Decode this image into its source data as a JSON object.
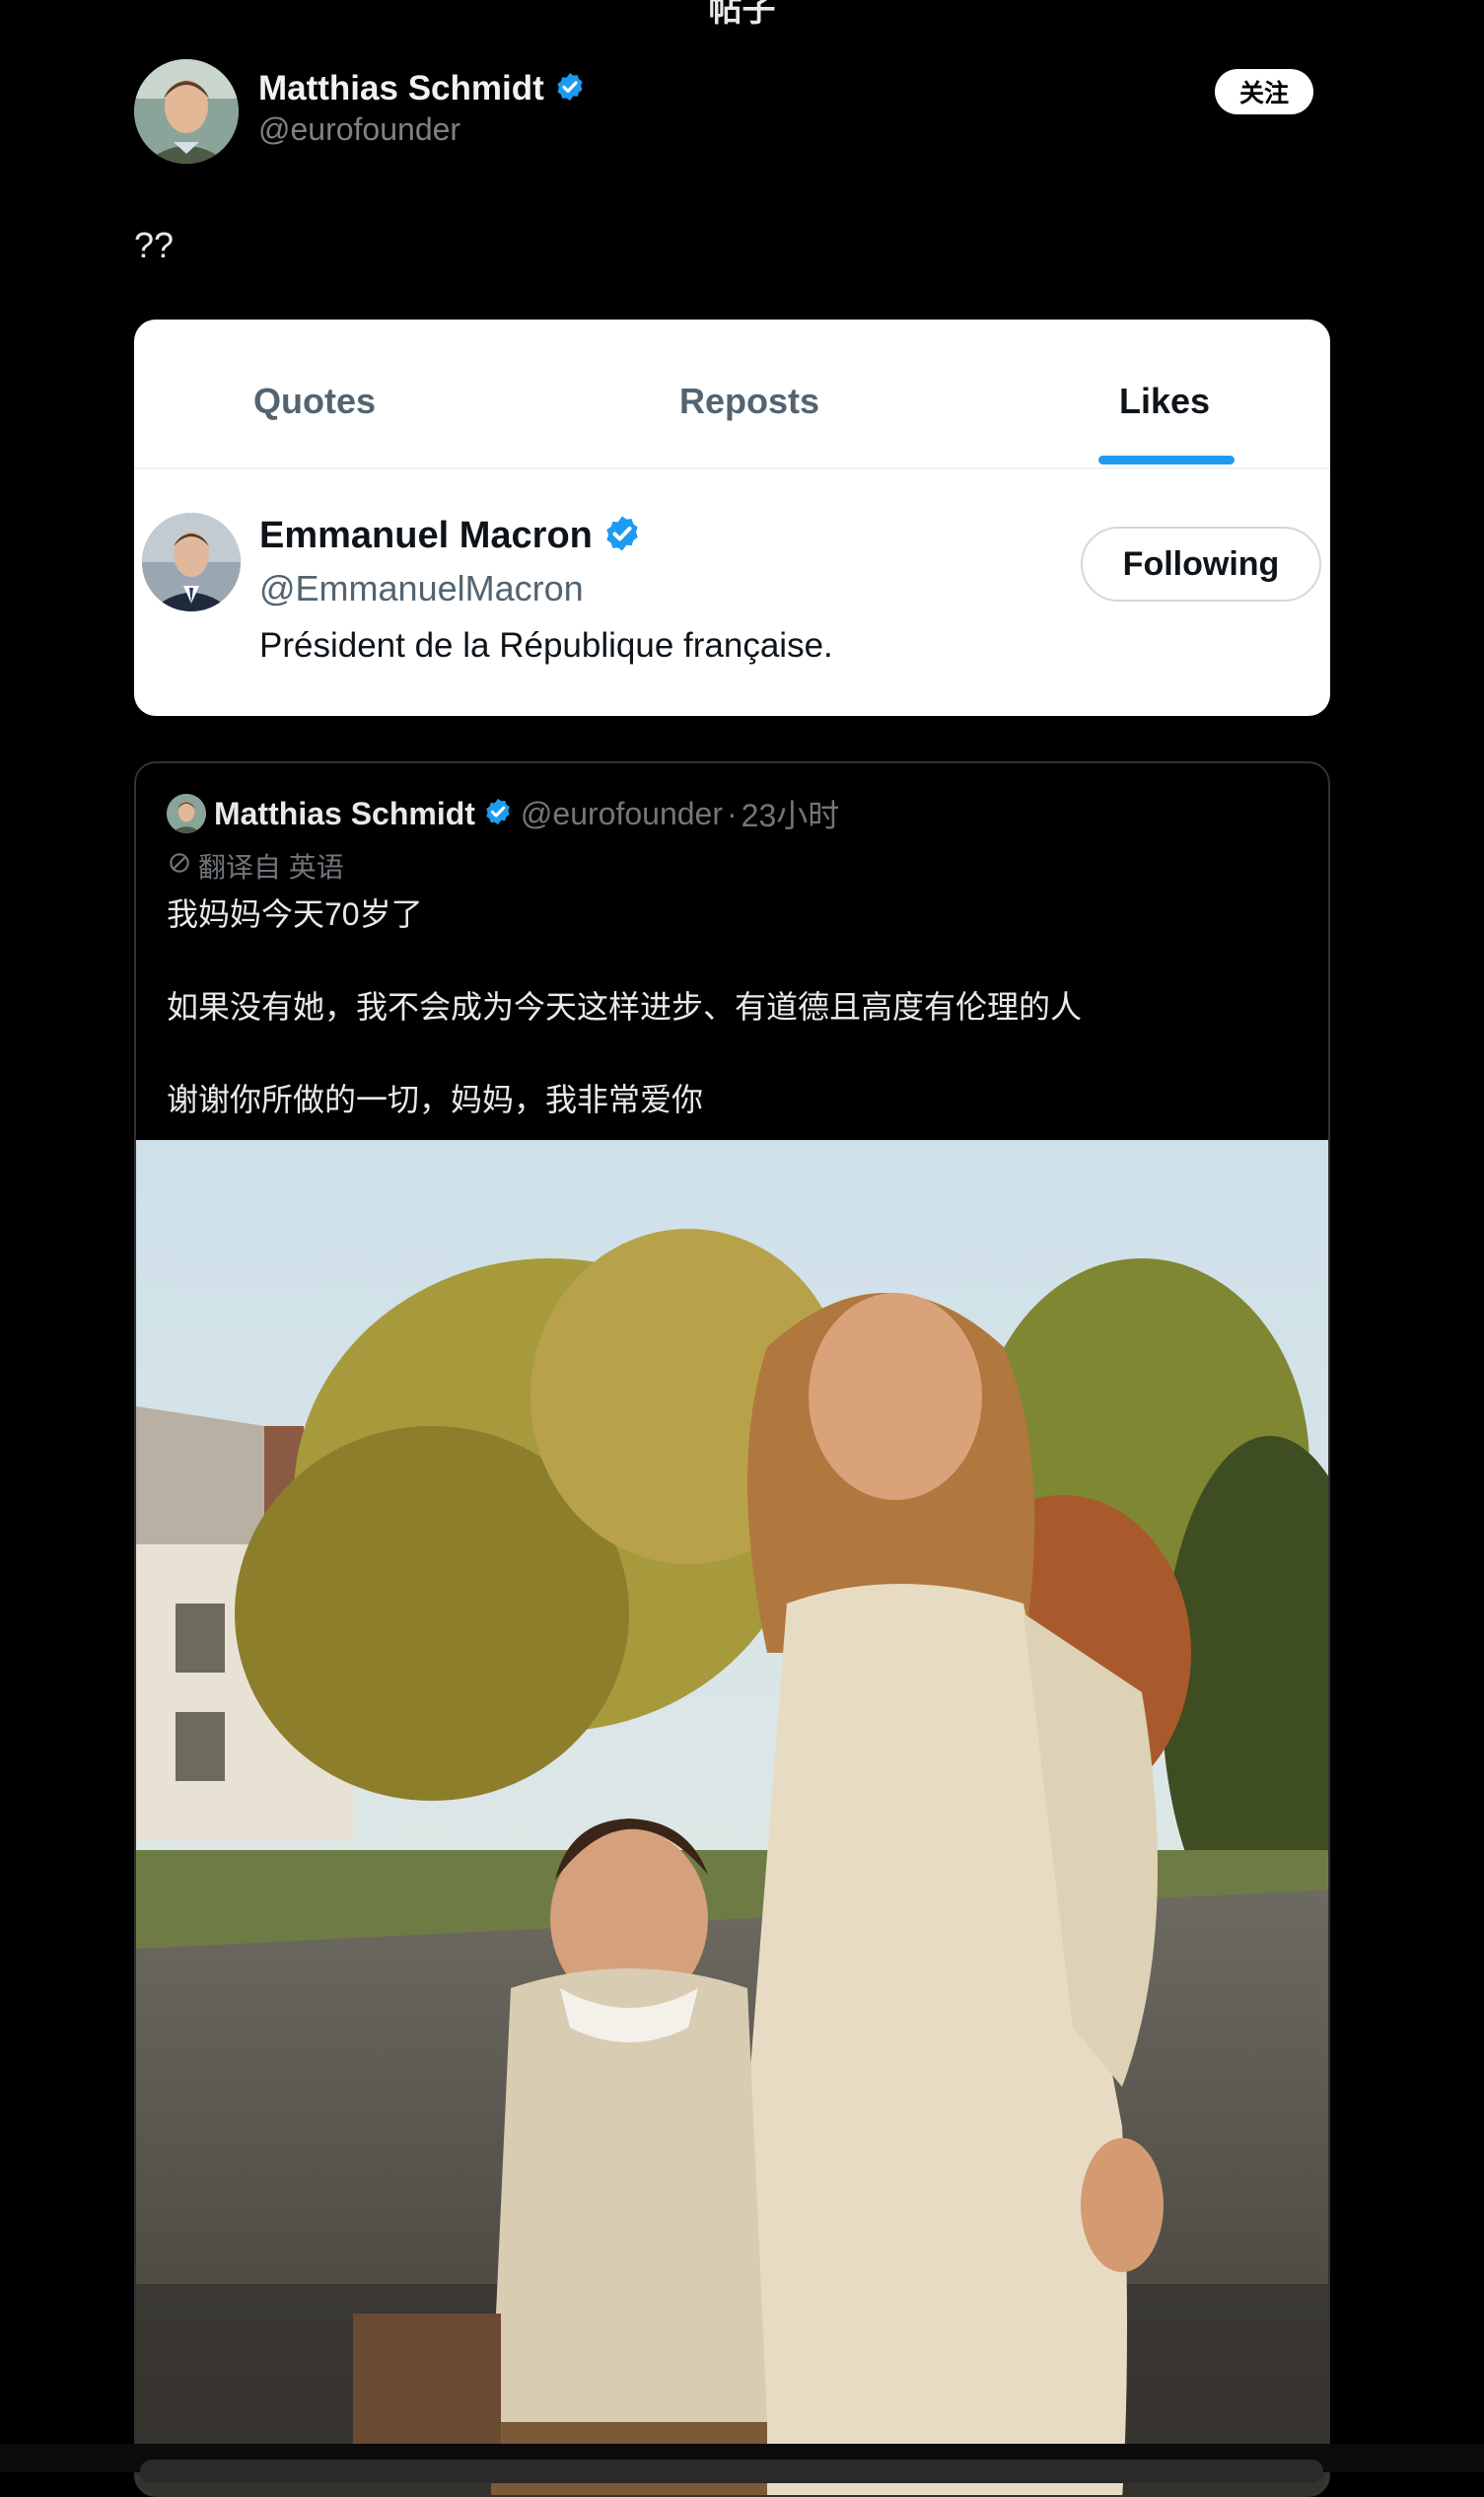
{
  "header": {
    "title": "帖子"
  },
  "author": {
    "name": "Matthias Schmidt",
    "handle": "@eurofounder",
    "follow_label": "关注",
    "post_text": "??"
  },
  "card": {
    "tabs": [
      {
        "label": "Quotes"
      },
      {
        "label": "Reposts"
      },
      {
        "label": "Likes",
        "active": true
      }
    ],
    "user": {
      "name": "Emmanuel Macron",
      "handle": "@EmmanuelMacron",
      "bio": "Président de la République française.",
      "follow_label": "Following"
    }
  },
  "quoted": {
    "name": "Matthias Schmidt",
    "handle": "@eurofounder",
    "separator": "·",
    "time": "23小时",
    "translation_note": "翻译自 英语",
    "lines": [
      "我妈妈今天70岁了",
      "如果没有她，我不会成为今天这样进步、有道德且高度有伦理的人",
      "谢谢你所做的一切，妈妈，我非常爱你"
    ]
  },
  "colors": {
    "background": "#000000",
    "verified": "#1d9bf0",
    "tab_active_underline": "#1d9bf0",
    "muted_text": "#71767b"
  }
}
